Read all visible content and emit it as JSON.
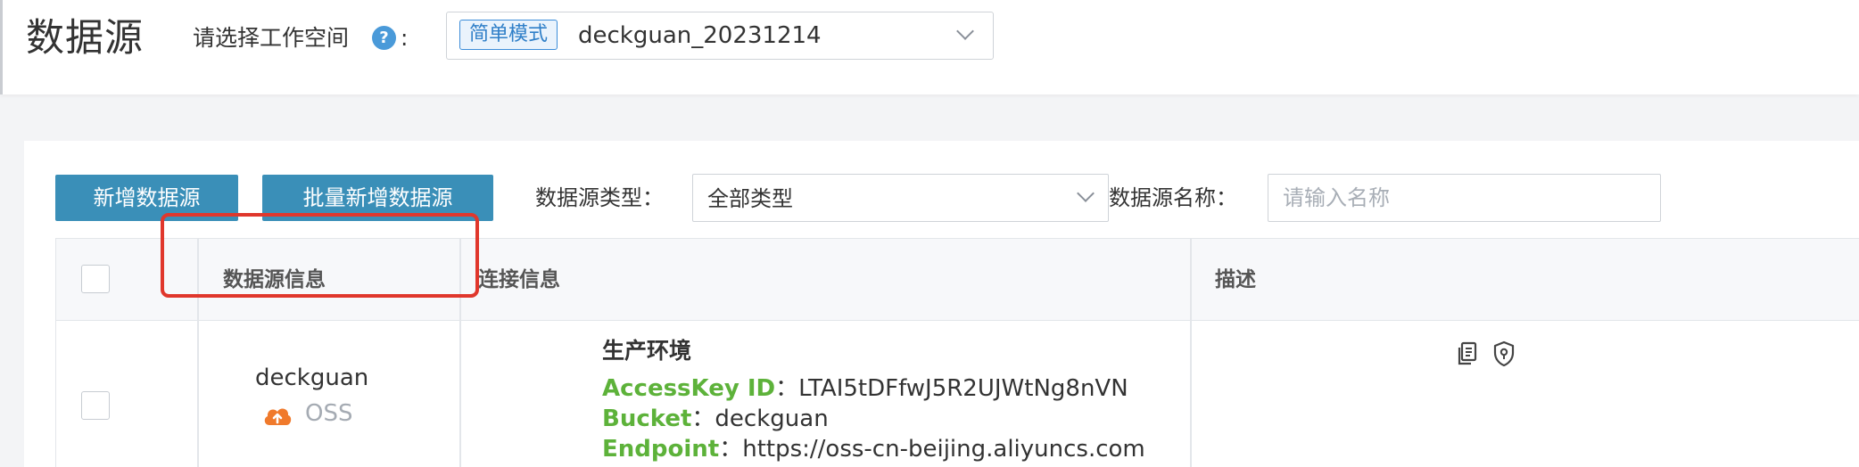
{
  "header": {
    "title": "数据源",
    "workspace_label": "请选择工作空间",
    "workspace_colon": ":",
    "help_icon": "?",
    "workspace_mode_tag": "简单模式",
    "workspace_value": "deckguan_20231214"
  },
  "toolbar": {
    "add_button": "新增数据源",
    "batch_add_button": "批量新增数据源",
    "type_filter_label": "数据源类型：",
    "type_filter_value": "全部类型",
    "name_filter_label": "数据源名称：",
    "name_filter_placeholder": "请输入名称"
  },
  "table": {
    "columns": [
      "数据源信息",
      "连接信息",
      "描述"
    ],
    "rows": [
      {
        "name": "deckguan",
        "type": "OSS",
        "env": "生产环境",
        "connection": [
          {
            "key": "AccessKey ID",
            "sep": "：",
            "value": "LTAI5tDFfwJ5R2UJWtNg8nVN"
          },
          {
            "key": "Bucket",
            "sep": "：",
            "value": "deckguan"
          },
          {
            "key": "Endpoint",
            "sep": "：",
            "value": "https://oss-cn-beijing.aliyuncs.com"
          }
        ]
      }
    ]
  },
  "colors": {
    "primary_button": "#3a8fb8",
    "key_green": "#5db23a",
    "highlight_red": "#e0372c",
    "oss_orange": "#f07a2c",
    "tag_blue": "#3c8dd9"
  },
  "icons": [
    "help-icon",
    "chevron-down-icon",
    "oss-cloud-icon",
    "copy-icon",
    "shield-icon"
  ]
}
